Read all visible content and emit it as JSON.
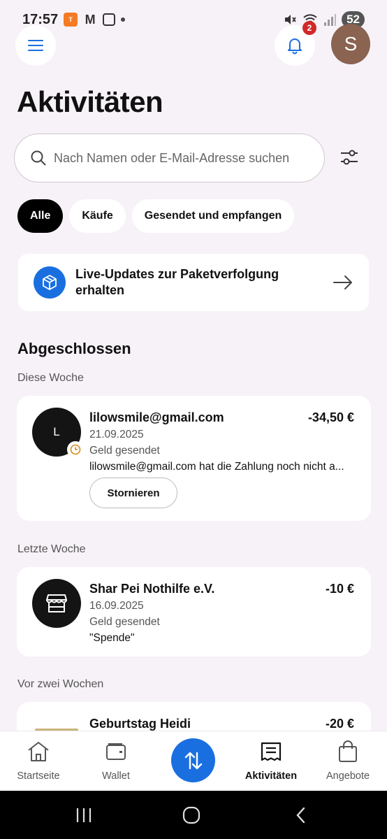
{
  "status_bar": {
    "time": "17:57",
    "battery": "52"
  },
  "header": {
    "notification_count": "2",
    "avatar_initial": "S"
  },
  "page": {
    "title": "Aktivitäten"
  },
  "search": {
    "placeholder": "Nach Namen oder E-Mail-Adresse suchen"
  },
  "filters": [
    {
      "label": "Alle",
      "active": true
    },
    {
      "label": "Käufe",
      "active": false
    },
    {
      "label": "Gesendet und empfangen",
      "active": false
    }
  ],
  "promo": {
    "text": "Live-Updates zur Paketverfolgung erhalten"
  },
  "section": {
    "heading": "Abgeschlossen"
  },
  "groups": [
    {
      "label": "Diese Woche",
      "items": [
        {
          "avatar": "L",
          "name": "lilowsmile@gmail.com",
          "amount": "-34,50 €",
          "date": "21.09.2025",
          "type": "Geld gesendet",
          "note": "lilowsmile@gmail.com hat die Zahlung noch nicht a...",
          "action": "Stornieren"
        }
      ]
    },
    {
      "label": "Letzte Woche",
      "items": [
        {
          "name": "Shar Pei Nothilfe e.V.",
          "amount": "-10 €",
          "date": "16.09.2025",
          "type": "Geld gesendet",
          "note": "\"Spende\""
        }
      ]
    },
    {
      "label": "Vor zwei Wochen",
      "items": [
        {
          "name": "Geburtstag Heidi",
          "amount": "-20 €"
        }
      ]
    }
  ],
  "bottom_nav": [
    {
      "label": "Startseite",
      "icon": "home-icon"
    },
    {
      "label": "Wallet",
      "icon": "wallet-icon"
    },
    {
      "label": "Aktivitäten",
      "icon": "activity-icon",
      "active": true
    },
    {
      "label": "Angebote",
      "icon": "shopping-bag-icon"
    }
  ],
  "colors": {
    "accent": "#1a6fe0",
    "background": "#f7f2f7",
    "badge": "#d02828"
  }
}
